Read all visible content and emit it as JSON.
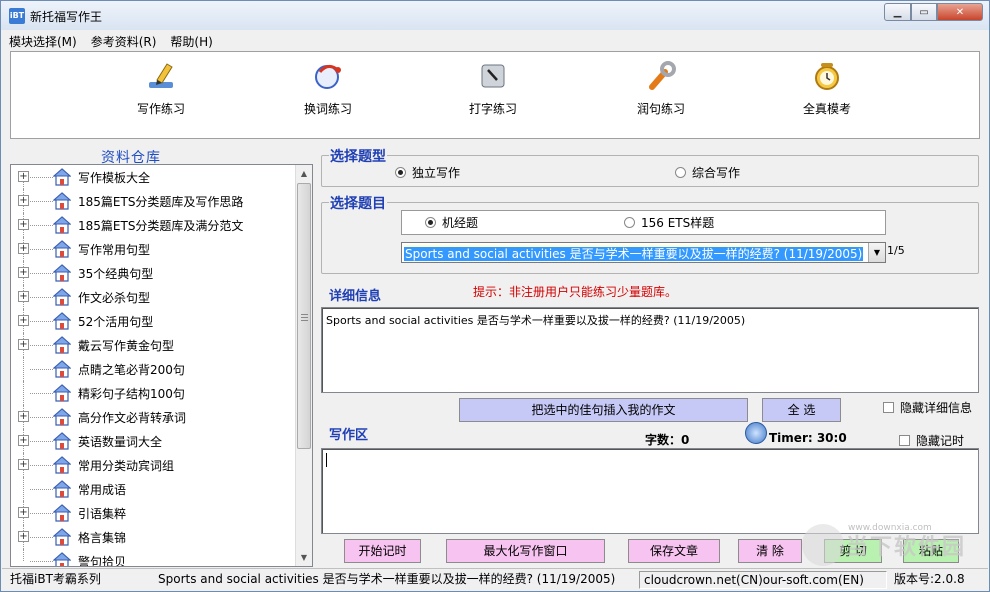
{
  "window": {
    "title": "新托福写作王",
    "app_icon": "iBT"
  },
  "menu": [
    "模块选择(M)",
    "参考资料(R)",
    "帮助(H)"
  ],
  "toolbar": [
    {
      "label": "写作练习",
      "icon": "pen-pencil-icon"
    },
    {
      "label": "换词练习",
      "icon": "swap-word-icon"
    },
    {
      "label": "打字练习",
      "icon": "keyboard-key-icon"
    },
    {
      "label": "润句练习",
      "icon": "wrench-icon"
    },
    {
      "label": "全真模考",
      "icon": "alarm-clock-icon"
    }
  ],
  "library": {
    "title": "资料仓库",
    "items": [
      {
        "label": "写作模板大全",
        "expandable": true
      },
      {
        "label": "185篇ETS分类题库及写作思路",
        "expandable": true
      },
      {
        "label": "185篇ETS分类题库及满分范文",
        "expandable": true
      },
      {
        "label": "写作常用句型",
        "expandable": true
      },
      {
        "label": "35个经典句型",
        "expandable": true
      },
      {
        "label": "作文必杀句型",
        "expandable": true
      },
      {
        "label": "52个活用句型",
        "expandable": true
      },
      {
        "label": "戴云写作黄金句型",
        "expandable": true
      },
      {
        "label": "点睛之笔必背200句",
        "expandable": false
      },
      {
        "label": "精彩句子结构100句",
        "expandable": false
      },
      {
        "label": "高分作文必背转承词",
        "expandable": true
      },
      {
        "label": "英语数量词大全",
        "expandable": true
      },
      {
        "label": "常用分类动宾词组",
        "expandable": true
      },
      {
        "label": "常用成语",
        "expandable": false
      },
      {
        "label": "引语集粹",
        "expandable": true
      },
      {
        "label": "格言集锦",
        "expandable": true
      },
      {
        "label": "警句拾贝",
        "expandable": false
      }
    ]
  },
  "question_type": {
    "title": "选择题型",
    "options": [
      "独立写作",
      "综合写作"
    ],
    "selected": 0
  },
  "question_select": {
    "title": "选择题目",
    "options": [
      "机经题",
      "156 ETS样题"
    ],
    "selected": 0,
    "dropdown_value": "Sports and social activities 是否与学术一样重要以及拔一样的经费? (11/19/2005)",
    "page": "1/5"
  },
  "detail": {
    "label": "详细信息",
    "hint": "提示：非注册用户只能练习少量题库。",
    "text": "Sports and social activities 是否与学术一样重要以及拔一样的经费? (11/19/2005)"
  },
  "actions": {
    "insert_label": "把选中的佳句插入我的作文",
    "select_all_label": "全 选",
    "hide_detail_label": "隐藏详细信息",
    "hide_timer_label": "隐藏记时"
  },
  "writing": {
    "label": "写作区",
    "word_count": "字数：0",
    "timer": "Timer: 30:0"
  },
  "bottom_buttons": {
    "start_timer": "开始记时",
    "maximize": "最大化写作窗口",
    "save": "保存文章",
    "clear": "清 除",
    "cut": "剪 切",
    "paste": "粘贴"
  },
  "status": {
    "series": "托福iBT考霸系列",
    "topic": "Sports and social activities 是否与学术一样重要以及拔一样的经费? (11/19/2005)",
    "site": "cloudcrown.net(CN)our-soft.com(EN)",
    "version": "版本号:2.0.8"
  },
  "watermark": {
    "text": "当下软件园",
    "url": "www.downxia.com"
  },
  "colors": {
    "accent_blue": "#1f3fb4",
    "hint_red": "#d40000",
    "btn_purple": "#c6c8f6",
    "btn_pink": "#f7c3f0",
    "btn_green": "#b9f1b1"
  }
}
